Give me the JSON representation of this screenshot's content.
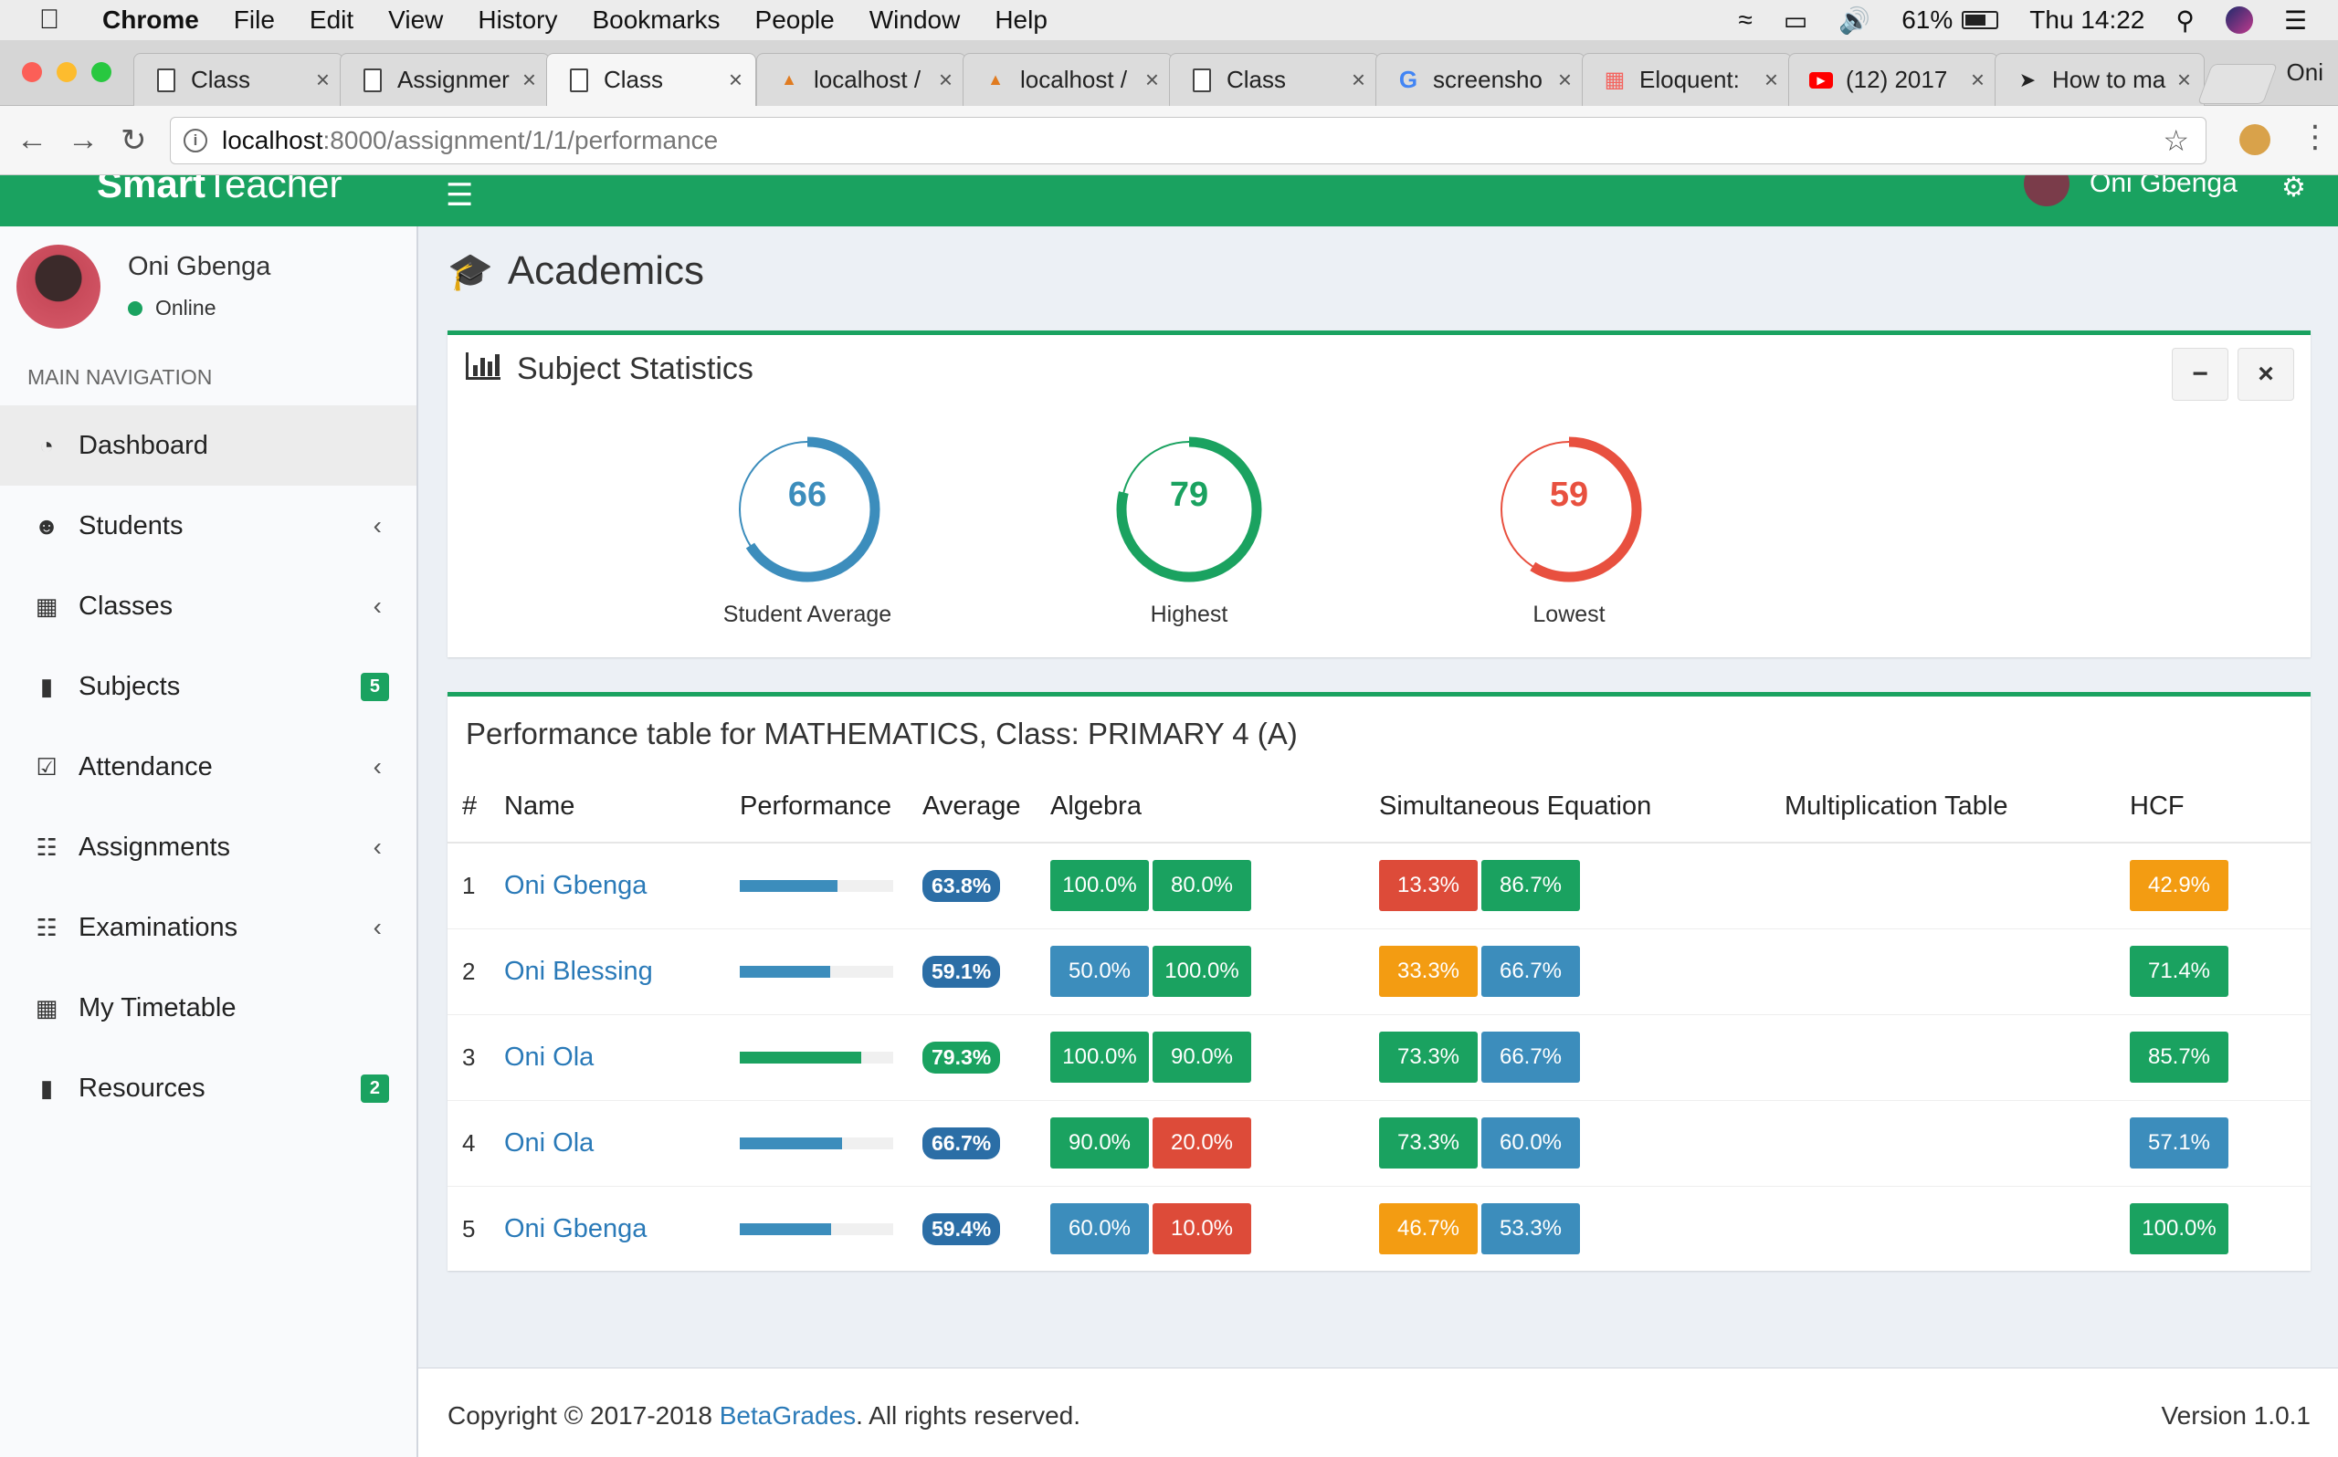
{
  "menubar": {
    "app": "Chrome",
    "items": [
      "File",
      "Edit",
      "View",
      "History",
      "Bookmarks",
      "People",
      "Window",
      "Help"
    ],
    "battery": "61%",
    "clock": "Thu 14:22"
  },
  "tabs": [
    {
      "title": "Class",
      "icon": "doc",
      "active": false
    },
    {
      "title": "Assignmer",
      "icon": "doc",
      "active": false
    },
    {
      "title": "Class",
      "icon": "doc",
      "active": true
    },
    {
      "title": "localhost / ",
      "icon": "pma",
      "active": false
    },
    {
      "title": "localhost / ",
      "icon": "pma",
      "active": false
    },
    {
      "title": "Class",
      "icon": "doc",
      "active": false
    },
    {
      "title": "screensho",
      "icon": "google",
      "active": false
    },
    {
      "title": "Eloquent: ",
      "icon": "laravel",
      "active": false
    },
    {
      "title": "(12) 2017 ",
      "icon": "youtube",
      "active": false
    },
    {
      "title": "How to ma",
      "icon": "arrow",
      "active": false
    }
  ],
  "profile_name": "Oni",
  "address": {
    "host": "localhost",
    "path": ":8000/assignment/1/1/performance"
  },
  "app": {
    "logo_bold": "Smart",
    "logo_rest": "Teacher",
    "header_user": "Oni Gbenga"
  },
  "sidebar": {
    "user_name": "Oni Gbenga",
    "status": "Online",
    "nav_header": "MAIN NAVIGATION",
    "items": [
      {
        "label": "Dashboard",
        "icon": "dashboard-icon",
        "chevron": false,
        "badge": ""
      },
      {
        "label": "Students",
        "icon": "users-icon",
        "chevron": true,
        "badge": ""
      },
      {
        "label": "Classes",
        "icon": "building-icon",
        "chevron": true,
        "badge": ""
      },
      {
        "label": "Subjects",
        "icon": "book-icon",
        "chevron": false,
        "badge": "5"
      },
      {
        "label": "Attendance",
        "icon": "calendar-check-icon",
        "chevron": true,
        "badge": ""
      },
      {
        "label": "Assignments",
        "icon": "list-icon",
        "chevron": true,
        "badge": ""
      },
      {
        "label": "Examinations",
        "icon": "list-icon",
        "chevron": true,
        "badge": ""
      },
      {
        "label": "My Timetable",
        "icon": "calendar-icon",
        "chevron": false,
        "badge": ""
      },
      {
        "label": "Resources",
        "icon": "book-icon",
        "chevron": false,
        "badge": "2"
      }
    ]
  },
  "page": {
    "title": "Academics"
  },
  "stats": {
    "title": "Subject Statistics",
    "items": [
      {
        "value": "66",
        "fraction": 0.66,
        "label": "Student Average",
        "color": "#3c8dbc"
      },
      {
        "value": "79",
        "fraction": 0.79,
        "label": "Highest",
        "color": "#1aa260"
      },
      {
        "value": "59",
        "fraction": 0.59,
        "label": "Lowest",
        "color": "#e8503f"
      }
    ]
  },
  "table": {
    "heading": "Performance table for MATHEMATICS, Class: PRIMARY 4 (A)",
    "columns": [
      "#",
      "Name",
      "Performance",
      "Average",
      "Algebra",
      "Simultaneous Equation",
      "Multiplication Table",
      "HCF"
    ],
    "rows": [
      {
        "num": "1",
        "name": "Oni Gbenga",
        "perf": 0.638,
        "avg": "63.8%",
        "algebra": [
          [
            "100.0%",
            "green"
          ],
          [
            "80.0%",
            "green"
          ]
        ],
        "simeq": [
          [
            "13.3%",
            "red"
          ],
          [
            "86.7%",
            "green"
          ]
        ],
        "mult": [],
        "hcf": [
          [
            "42.9%",
            "orange"
          ]
        ]
      },
      {
        "num": "2",
        "name": "Oni Blessing",
        "perf": 0.591,
        "avg": "59.1%",
        "algebra": [
          [
            "50.0%",
            "blue"
          ],
          [
            "100.0%",
            "green"
          ]
        ],
        "simeq": [
          [
            "33.3%",
            "orange"
          ],
          [
            "66.7%",
            "blue"
          ]
        ],
        "mult": [],
        "hcf": [
          [
            "71.4%",
            "green"
          ]
        ]
      },
      {
        "num": "3",
        "name": "Oni Ola",
        "perf": 0.793,
        "avg": "79.3%",
        "algebra": [
          [
            "100.0%",
            "green"
          ],
          [
            "90.0%",
            "green"
          ]
        ],
        "simeq": [
          [
            "73.3%",
            "green"
          ],
          [
            "66.7%",
            "blue"
          ]
        ],
        "mult": [],
        "hcf": [
          [
            "85.7%",
            "green"
          ]
        ]
      },
      {
        "num": "4",
        "name": "Oni Ola",
        "perf": 0.667,
        "avg": "66.7%",
        "algebra": [
          [
            "90.0%",
            "green"
          ],
          [
            "20.0%",
            "red"
          ]
        ],
        "simeq": [
          [
            "73.3%",
            "green"
          ],
          [
            "60.0%",
            "blue"
          ]
        ],
        "mult": [],
        "hcf": [
          [
            "57.1%",
            "blue"
          ]
        ]
      },
      {
        "num": "5",
        "name": "Oni Gbenga",
        "perf": 0.594,
        "avg": "59.4%",
        "algebra": [
          [
            "60.0%",
            "blue"
          ],
          [
            "10.0%",
            "red"
          ]
        ],
        "simeq": [
          [
            "46.7%",
            "orange"
          ],
          [
            "53.3%",
            "blue"
          ]
        ],
        "mult": [],
        "hcf": [
          [
            "100.0%",
            "green"
          ]
        ]
      }
    ]
  },
  "footer": {
    "copyright_pre": "Copyright © 2017-2018 ",
    "brand": "BetaGrades",
    "copyright_post": ". All rights reserved.",
    "version": "Version 1.0.1"
  }
}
